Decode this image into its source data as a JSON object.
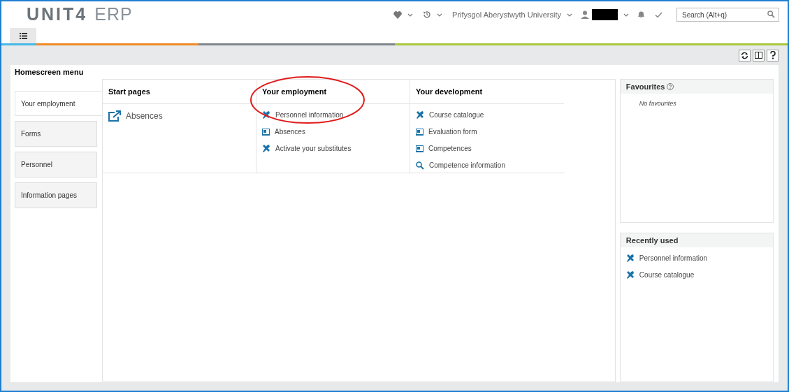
{
  "header": {
    "logo_brand": "UNIT4",
    "logo_product": "ERP",
    "company": "Prifysgol Aberystwyth University",
    "search": {
      "placeholder": "Search (Alt+q)"
    }
  },
  "page": {
    "title": "Homescreen menu"
  },
  "sidebar": {
    "items": [
      {
        "label": "Your employment",
        "selected": true
      },
      {
        "label": "Forms",
        "selected": false
      },
      {
        "label": "Personnel",
        "selected": false
      },
      {
        "label": "Information pages",
        "selected": false
      }
    ]
  },
  "columns": [
    {
      "title": "Start pages",
      "items": [
        {
          "label": "Absences",
          "kind": "external"
        }
      ]
    },
    {
      "title": "Your employment",
      "highlighted": true,
      "items": [
        {
          "label": "Personnel information",
          "kind": "tool"
        },
        {
          "label": "Absences",
          "kind": "form"
        },
        {
          "label": "Activate your substitutes",
          "kind": "tool"
        }
      ]
    },
    {
      "title": "Your development",
      "highlighted": false,
      "items": [
        {
          "label": "Course catalogue",
          "kind": "tool"
        },
        {
          "label": "Evaluation form",
          "kind": "form"
        },
        {
          "label": "Competences",
          "kind": "form"
        },
        {
          "label": "Competence information",
          "kind": "search"
        }
      ]
    }
  ],
  "favourites": {
    "title": "Favourites",
    "empty_text": "No favourites"
  },
  "recently_used": {
    "title": "Recently used",
    "items": [
      {
        "label": "Personnel information",
        "kind": "tool"
      },
      {
        "label": "Course catalogue",
        "kind": "tool"
      }
    ]
  }
}
